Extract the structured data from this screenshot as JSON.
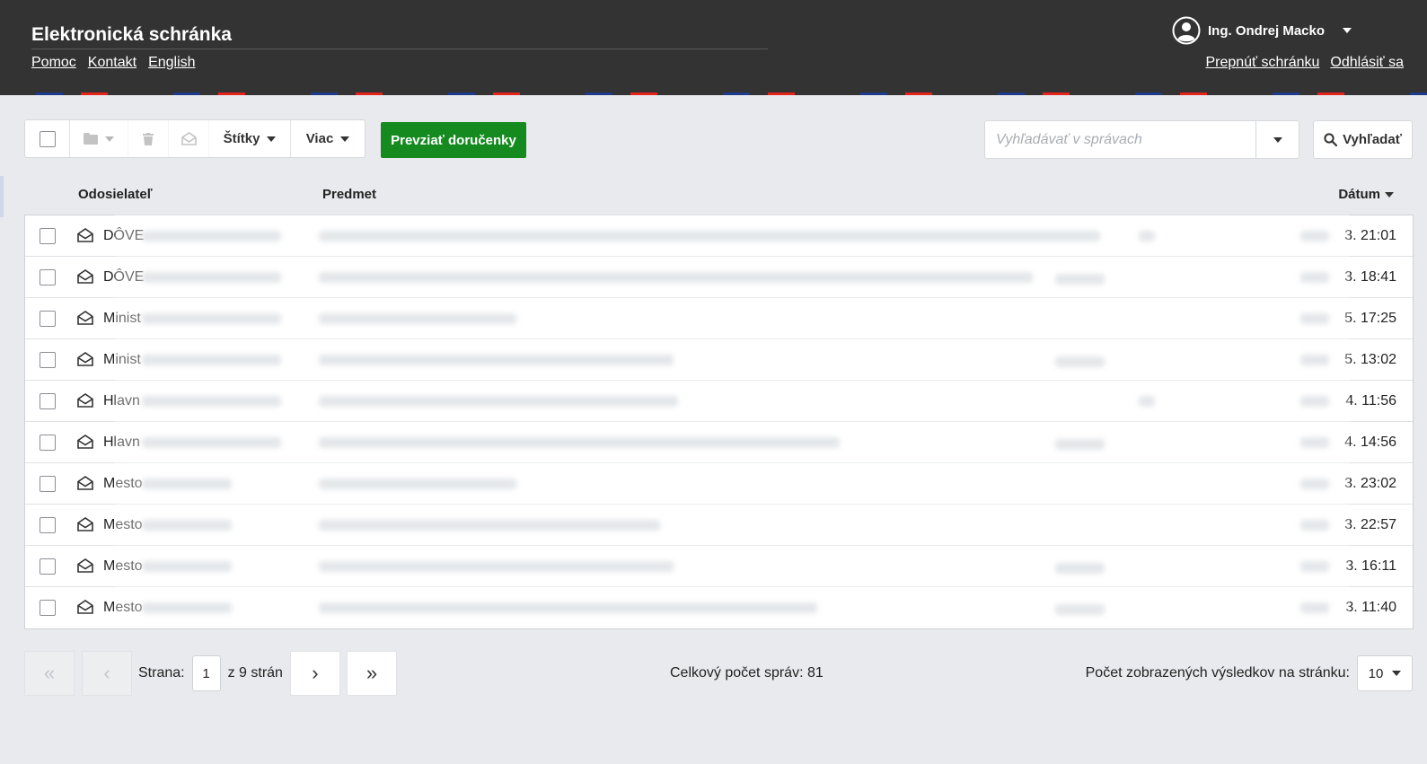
{
  "header": {
    "title": "Elektronická schránka",
    "nav": [
      "Pomoc",
      "Kontakt",
      "English"
    ],
    "user_name": "Ing. Ondrej Macko",
    "switch_box": "Prepnúť schránku",
    "logout": "Odhlásiť sa"
  },
  "toolbar": {
    "labels_btn": "Štítky",
    "more_btn": "Viac",
    "receive_btn": "Prevziať doručenky",
    "search_placeholder": "Vyhľadávať v správach",
    "search_btn": "Vyhľadať"
  },
  "table": {
    "col_sender": "Odosielateľ",
    "col_subject": "Predmet",
    "col_date": "Dátum",
    "rows": [
      {
        "sender": "DÔVE",
        "date": "3. 21:01"
      },
      {
        "sender": "DÔVE",
        "date": "3. 18:41"
      },
      {
        "sender": "Minist",
        "date": "5. 17:25"
      },
      {
        "sender": "Minist",
        "date": "5. 13:02"
      },
      {
        "sender": "Hlavn",
        "date": "4. 11:56"
      },
      {
        "sender": "Hlavn",
        "date": "4. 14:56"
      },
      {
        "sender": "Mesto",
        "date": "3. 23:02"
      },
      {
        "sender": "Mesto",
        "date": "3. 22:57"
      },
      {
        "sender": "Mesto",
        "date": "3. 16:11"
      },
      {
        "sender": "Mesto",
        "date": "3. 11:40"
      }
    ]
  },
  "pagination": {
    "page_label": "Strana:",
    "page": "1",
    "of_pages": "z 9 strán",
    "total": "Celkový počet správ: 81",
    "per_page_label": "Počet zobrazených výsledkov na stránku:",
    "per_page": "10"
  }
}
